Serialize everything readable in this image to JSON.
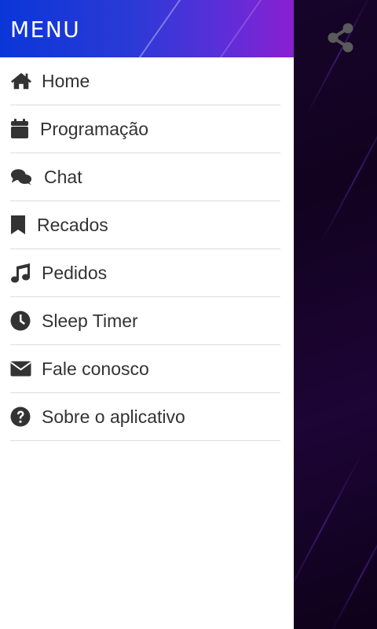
{
  "drawer": {
    "title": "MENU",
    "items": [
      {
        "label": "Home",
        "icon": "home-icon"
      },
      {
        "label": "Programação",
        "icon": "calendar-icon"
      },
      {
        "label": "Chat",
        "icon": "chat-icon"
      },
      {
        "label": "Recados",
        "icon": "bookmark-icon"
      },
      {
        "label": "Pedidos",
        "icon": "music-icon"
      },
      {
        "label": "Sleep Timer",
        "icon": "clock-icon"
      },
      {
        "label": "Fale conosco",
        "icon": "envelope-icon"
      },
      {
        "label": "Sobre o aplicativo",
        "icon": "question-circle-icon"
      }
    ]
  },
  "topbar": {
    "share_icon": "share-icon"
  },
  "colors": {
    "header_start": "#0a36d8",
    "header_end": "#8a1fd0",
    "icon": "#333333",
    "background": "#12021f"
  }
}
